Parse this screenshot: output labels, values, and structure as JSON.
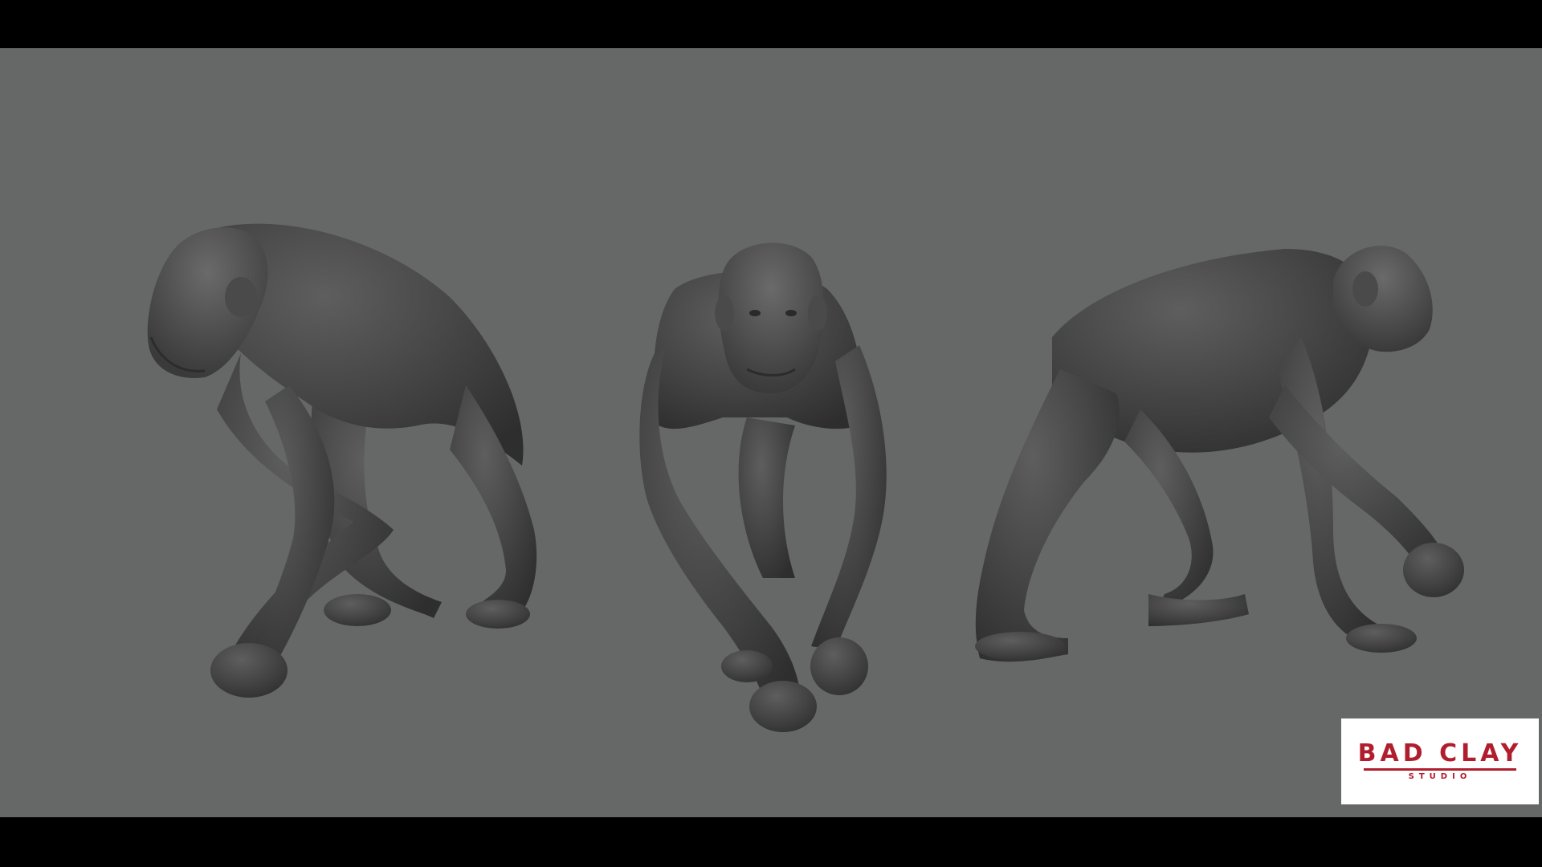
{
  "scene": {
    "background_color": "#666868",
    "letterbox_color": "#000000",
    "subject": "chimpanzee-sculpt",
    "views": [
      "left-three-quarter",
      "front",
      "right-side"
    ]
  },
  "watermark": {
    "text_main": "BAD CLAY",
    "text_sub": "STUDIO",
    "color": "#b01e2e",
    "background": "#ffffff"
  }
}
